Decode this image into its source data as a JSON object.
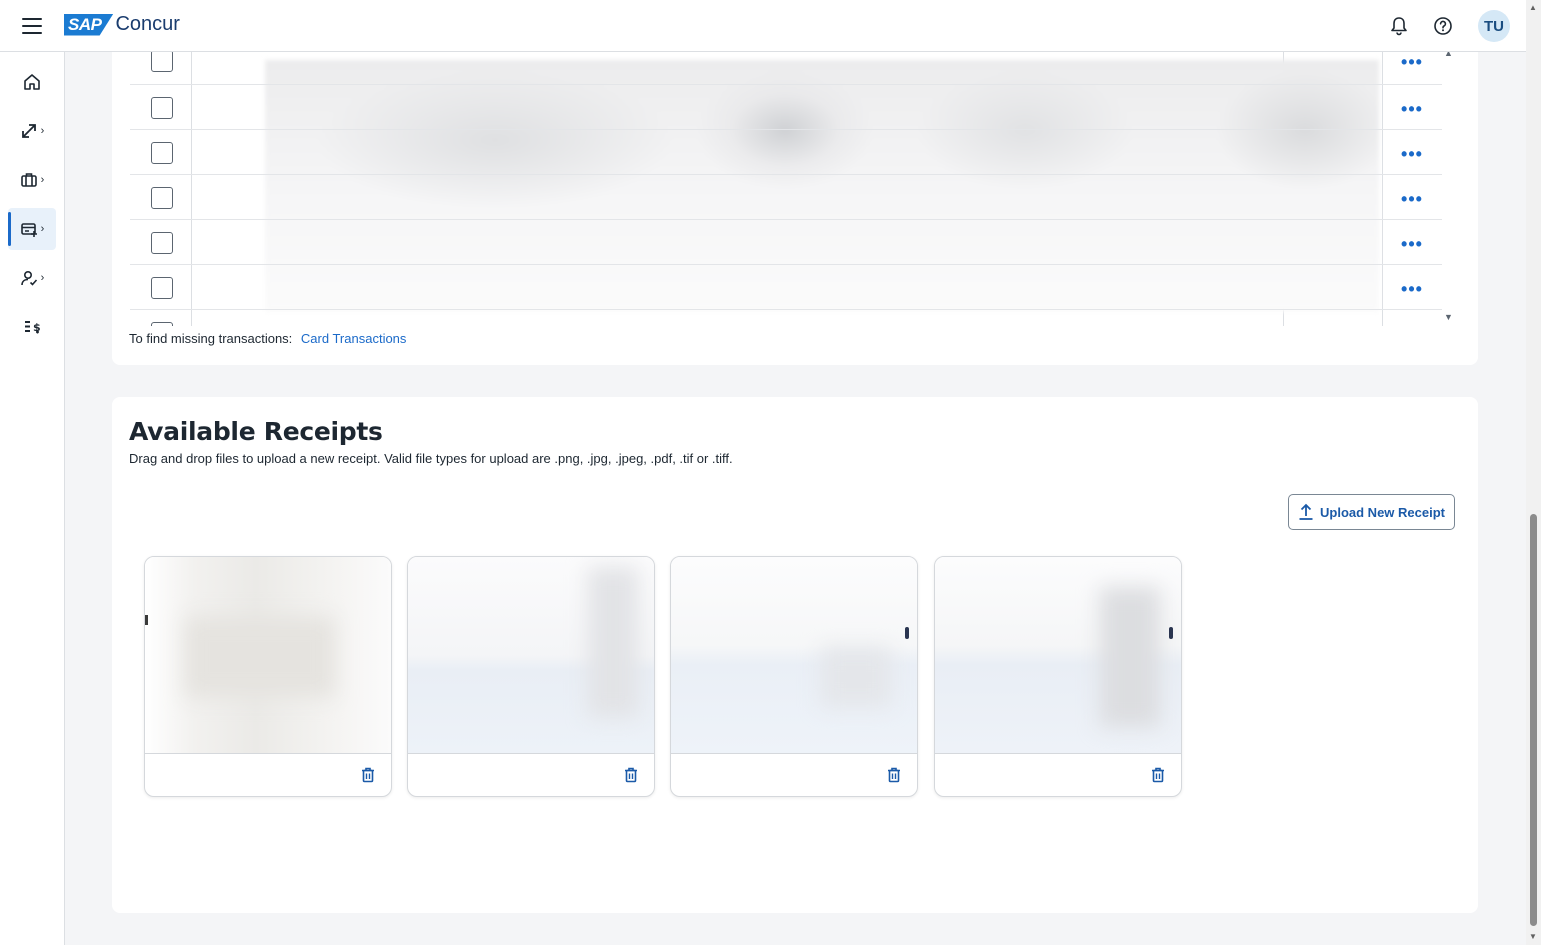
{
  "app": {
    "brand_sap": "SAP",
    "brand_name": "Concur",
    "user_initials": "TU"
  },
  "colors": {
    "accent": "#1b6ac9",
    "brand": "#1b7bd2",
    "border": "#dcdfe3"
  },
  "topbar": {
    "icons": [
      "menu-icon",
      "bell-icon",
      "help-icon"
    ]
  },
  "sidebar": {
    "items": [
      {
        "icon": "home-icon",
        "active": false
      },
      {
        "icon": "travel-request-icon",
        "active": false
      },
      {
        "icon": "trip-briefcase-icon",
        "active": false
      },
      {
        "icon": "expense-icon",
        "active": true
      },
      {
        "icon": "approvals-person-icon",
        "active": false
      },
      {
        "icon": "reports-icon",
        "active": false
      }
    ]
  },
  "transactions": {
    "row_count": 6,
    "find_missing_label": "To find missing transactions:",
    "find_missing_link": "Card Transactions"
  },
  "receipts": {
    "title": "Available Receipts",
    "description": "Drag and drop files to upload a new receipt. Valid file types for upload are .png, .jpg, .jpeg, .pdf, .tif or .tiff.",
    "upload_label": "Upload New Receipt",
    "cards": [
      {
        "thumbnail": "receipt-1",
        "delete_icon": "trash-icon"
      },
      {
        "thumbnail": "receipt-2",
        "delete_icon": "trash-icon"
      },
      {
        "thumbnail": "receipt-3",
        "delete_icon": "trash-icon"
      },
      {
        "thumbnail": "receipt-4",
        "delete_icon": "trash-icon"
      }
    ]
  }
}
